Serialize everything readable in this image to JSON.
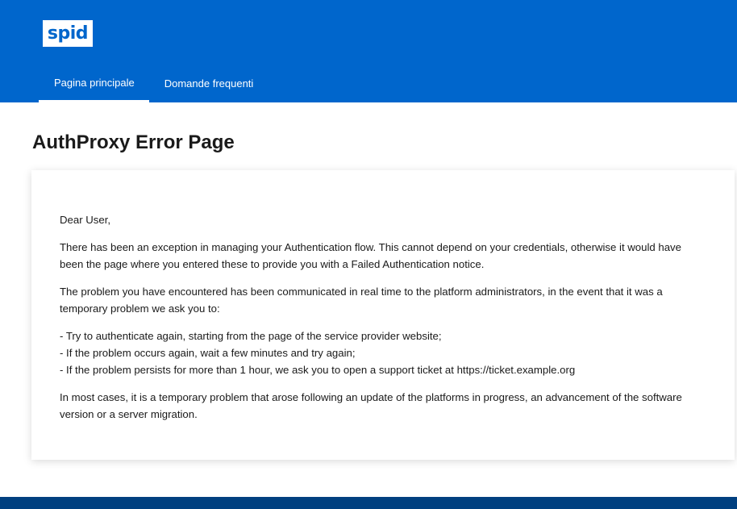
{
  "header": {
    "logo_text": "spid",
    "nav": [
      {
        "label": "Pagina principale",
        "active": true
      },
      {
        "label": "Domande frequenti",
        "active": false
      }
    ]
  },
  "main": {
    "title": "AuthProxy Error Page",
    "card": {
      "greeting": "Dear User,",
      "paragraph1": "There has been an exception in managing your Authentication flow. This cannot depend on your credentials, otherwise it would have been the page where you entered these to provide you with a Failed Authentication notice.",
      "paragraph2": "The problem you have encountered has been communicated in real time to the platform administrators, in the event that it was a temporary problem we ask you to:",
      "list": [
        "- Try to authenticate again, starting from the page of the service provider website;",
        "- If the problem occurs again, wait a few minutes and try again;",
        "- If the problem persists for more than 1 hour, we ask you to open a support ticket at https://ticket.example.org"
      ],
      "paragraph3": "In most cases, it is a temporary problem that arose following an update of the platforms in progress, an advancement of the software version or a server migration."
    }
  },
  "colors": {
    "header_bg": "#0066cc",
    "footer_bg": "#004080",
    "text": "#1a1a1a"
  }
}
